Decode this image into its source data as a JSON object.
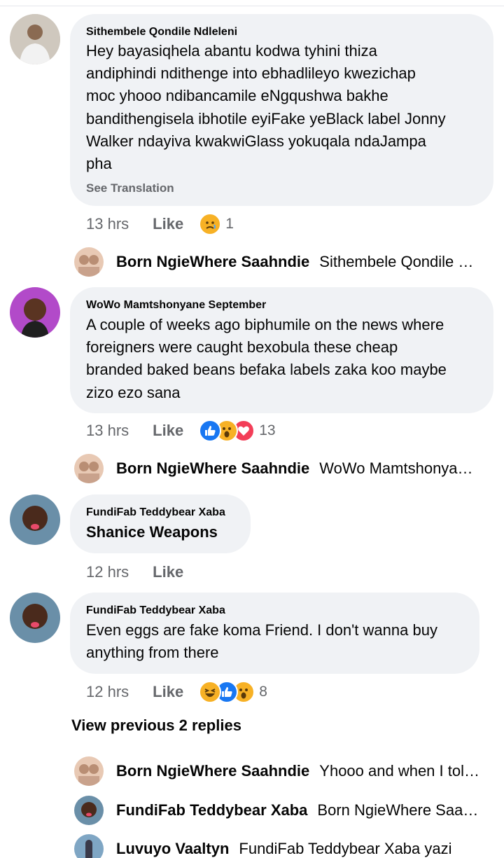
{
  "comments": [
    {
      "author": "Sithembele Qondile Ndleleni",
      "lines": [
        "Hey bayasiqhela abantu kodwa tyhini thiza",
        "andiphindi ndithenge into ebhadlileyo kwezichap",
        "moc yhooo ndibancamile eNgqushwa bakhe",
        "bandithengisela ibhotile eyiFake yeBlack label Jonny",
        "Walker  ndayiva kwakwiGlass yokuqala ndaJampa",
        "pha"
      ],
      "see_translation": "See Translation",
      "time": "13 hrs",
      "like": "Like",
      "reactions": [
        "sad"
      ],
      "reaction_count": "1"
    },
    {
      "author": "WoWo Mamtshonyane September",
      "lines": [
        "A couple of weeks ago biphumile on the news where",
        "foreigners were caught bexobula these cheap",
        "branded baked beans befaka labels zaka koo maybe",
        "zizo ezo sana"
      ],
      "time": "13 hrs",
      "like": "Like",
      "reactions": [
        "like",
        "wow",
        "love"
      ],
      "reaction_count": "13"
    },
    {
      "author": "FundiFab Teddybear Xaba",
      "lines": [
        "Shanice Weapons"
      ],
      "time": "12 hrs",
      "like": "Like"
    },
    {
      "author": "FundiFab Teddybear Xaba",
      "lines": [
        "Even eggs are fake koma Friend. I don't wanna buy",
        "anything from there"
      ],
      "time": "12 hrs",
      "like": "Like",
      "reactions": [
        "haha",
        "like",
        "wow"
      ],
      "reaction_count": "8"
    }
  ],
  "replies": [
    {
      "name": "Born NgieWhere Saahndie",
      "preview": "Sithembele Qondile Ndleleni"
    },
    {
      "name": "Born NgieWhere Saahndie",
      "preview": "WoWo Mamtshonyane September"
    },
    {
      "name": "Born NgieWhere Saahndie",
      "preview": "Yhooo and when I told them"
    },
    {
      "name": "FundiFab Teddybear Xaba",
      "preview": "Born NgieWhere Saahndie"
    },
    {
      "name": "Luvuyo Vaaltyn",
      "preview": "FundiFab Teddybear Xaba yazi"
    }
  ],
  "view_previous": "View previous 2 replies",
  "colors": {
    "bubble": "#f0f2f5",
    "meta_gray": "#65676b",
    "like_blue": "#1877f2",
    "love_red": "#f33e58",
    "emoji_yellow": "#f7b125"
  }
}
